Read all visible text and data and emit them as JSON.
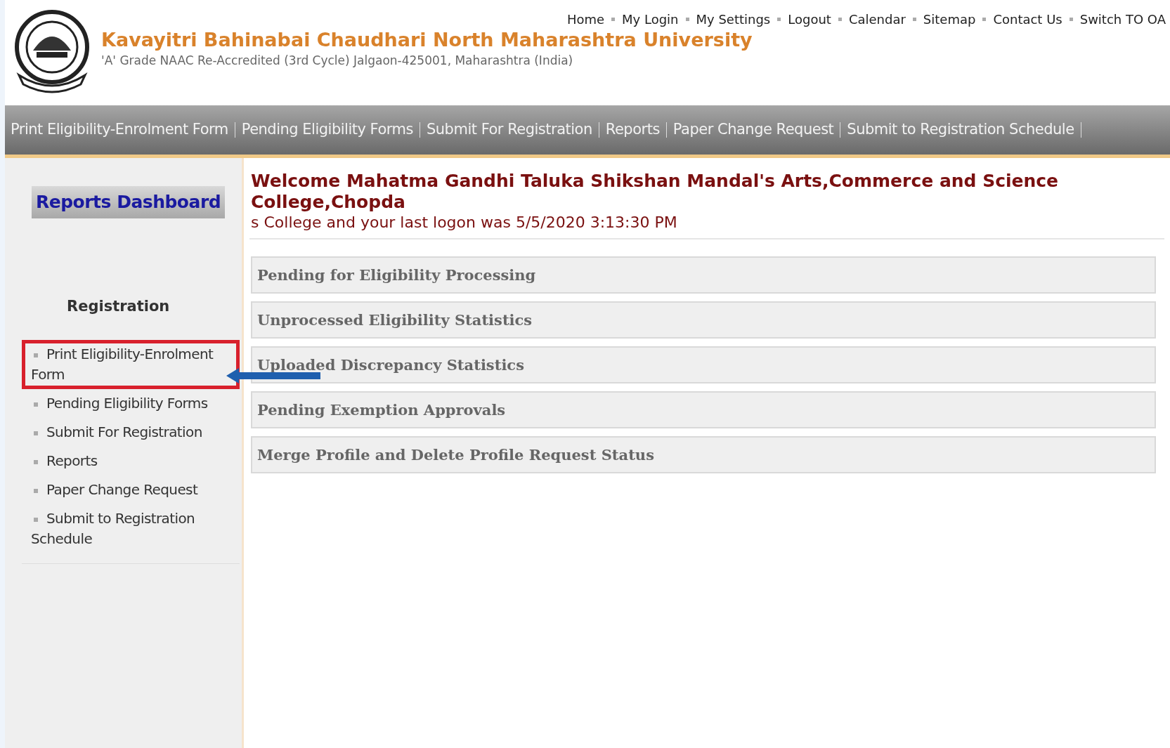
{
  "header": {
    "university_name": "Kavayitri Bahinabai Chaudhari North Maharashtra University",
    "subtitle": "'A' Grade NAAC Re-Accredited (3rd Cycle) Jalgaon-425001, Maharashtra (India)",
    "top_links": [
      "Home",
      "My Login",
      "My Settings",
      "Logout",
      "Calendar",
      "Sitemap",
      "Contact Us",
      "Switch TO OA"
    ]
  },
  "nav_bar": {
    "items": [
      "Print Eligibility-Enrolment Form",
      "Pending Eligibility Forms",
      "Submit For Registration",
      "Reports",
      "Paper Change Request",
      "Submit to Registration Schedule"
    ]
  },
  "sidebar": {
    "title": "Reports Dashboard",
    "section": "Registration",
    "items": [
      {
        "label": "Print Eligibility-Enrolment Form",
        "highlighted": true
      },
      {
        "label": "Pending Eligibility Forms",
        "highlighted": false
      },
      {
        "label": "Submit For Registration",
        "highlighted": false
      },
      {
        "label": "Reports",
        "highlighted": false
      },
      {
        "label": "Paper Change Request",
        "highlighted": false
      },
      {
        "label": "Submit to Registration Schedule",
        "highlighted": false
      }
    ]
  },
  "welcome": {
    "heading": "Welcome Mahatma Gandhi Taluka Shikshan Mandal's Arts,Commerce and Science College,Chopda",
    "logon": "s College and your last logon was 5/5/2020 3:13:30 PM"
  },
  "panels": [
    "Pending for Eligibility Processing",
    "Unprocessed Eligibility Statistics",
    "Uploaded Discrepancy Statistics",
    "Pending Exemption Approvals",
    "Merge Profile and Delete Profile Request Status"
  ]
}
